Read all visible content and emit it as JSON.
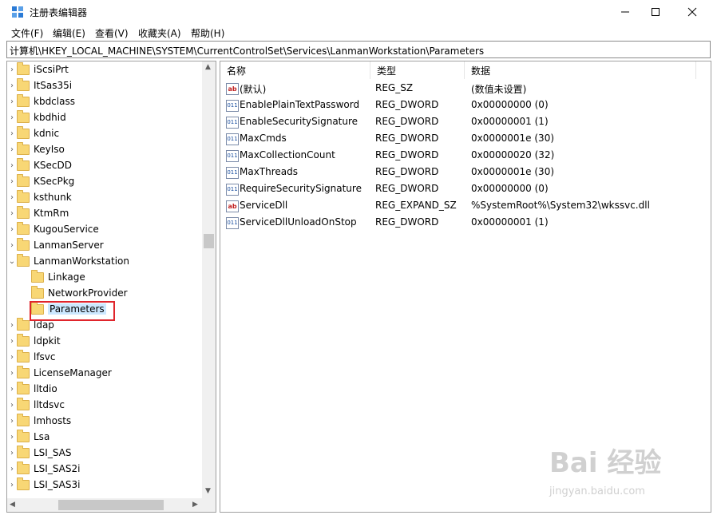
{
  "window": {
    "title": "注册表编辑器",
    "controls": {
      "minimize": "—",
      "maximize": "☐",
      "close": "✕"
    }
  },
  "menu": [
    "文件(F)",
    "编辑(E)",
    "查看(V)",
    "收藏夹(A)",
    "帮助(H)"
  ],
  "address": "计算机\\HKEY_LOCAL_MACHINE\\SYSTEM\\CurrentControlSet\\Services\\LanmanWorkstation\\Parameters",
  "tree": {
    "items": [
      {
        "label": "iScsiPrt",
        "expander": "›",
        "level": 0
      },
      {
        "label": "ItSas35i",
        "expander": "›",
        "level": 0
      },
      {
        "label": "kbdclass",
        "expander": "›",
        "level": 0
      },
      {
        "label": "kbdhid",
        "expander": "›",
        "level": 0
      },
      {
        "label": "kdnic",
        "expander": "›",
        "level": 0
      },
      {
        "label": "KeyIso",
        "expander": "›",
        "level": 0
      },
      {
        "label": "KSecDD",
        "expander": "›",
        "level": 0
      },
      {
        "label": "KSecPkg",
        "expander": "›",
        "level": 0
      },
      {
        "label": "ksthunk",
        "expander": "›",
        "level": 0
      },
      {
        "label": "KtmRm",
        "expander": "›",
        "level": 0
      },
      {
        "label": "KugouService",
        "expander": "›",
        "level": 0
      },
      {
        "label": "LanmanServer",
        "expander": "›",
        "level": 0
      },
      {
        "label": "LanmanWorkstation",
        "expander": "⌄",
        "level": 0
      },
      {
        "label": "Linkage",
        "expander": "",
        "level": 1
      },
      {
        "label": "NetworkProvider",
        "expander": "",
        "level": 1
      },
      {
        "label": "Parameters",
        "expander": "",
        "level": 1,
        "selected": true
      },
      {
        "label": "ldap",
        "expander": "›",
        "level": 0
      },
      {
        "label": "ldpkit",
        "expander": "›",
        "level": 0
      },
      {
        "label": "lfsvc",
        "expander": "›",
        "level": 0
      },
      {
        "label": "LicenseManager",
        "expander": "›",
        "level": 0
      },
      {
        "label": "lltdio",
        "expander": "›",
        "level": 0
      },
      {
        "label": "lltdsvc",
        "expander": "›",
        "level": 0
      },
      {
        "label": "lmhosts",
        "expander": "›",
        "level": 0
      },
      {
        "label": "Lsa",
        "expander": "›",
        "level": 0
      },
      {
        "label": "LSI_SAS",
        "expander": "›",
        "level": 0
      },
      {
        "label": "LSI_SAS2i",
        "expander": "›",
        "level": 0
      },
      {
        "label": "LSI_SAS3i",
        "expander": "›",
        "level": 0
      }
    ]
  },
  "list": {
    "headers": [
      "名称",
      "类型",
      "数据"
    ],
    "rows": [
      {
        "icon": "ab",
        "name": "(默认)",
        "type": "REG_SZ",
        "data": "(数值未设置)"
      },
      {
        "icon": "011",
        "name": "EnablePlainTextPassword",
        "type": "REG_DWORD",
        "data": "0x00000000 (0)"
      },
      {
        "icon": "011",
        "name": "EnableSecuritySignature",
        "type": "REG_DWORD",
        "data": "0x00000001 (1)"
      },
      {
        "icon": "011",
        "name": "MaxCmds",
        "type": "REG_DWORD",
        "data": "0x0000001e (30)"
      },
      {
        "icon": "011",
        "name": "MaxCollectionCount",
        "type": "REG_DWORD",
        "data": "0x00000020 (32)"
      },
      {
        "icon": "011",
        "name": "MaxThreads",
        "type": "REG_DWORD",
        "data": "0x0000001e (30)"
      },
      {
        "icon": "011",
        "name": "RequireSecuritySignature",
        "type": "REG_DWORD",
        "data": "0x00000000 (0)"
      },
      {
        "icon": "ab",
        "name": "ServiceDll",
        "type": "REG_EXPAND_SZ",
        "data": "%SystemRoot%\\System32\\wkssvc.dll"
      },
      {
        "icon": "011",
        "name": "ServiceDllUnloadOnStop",
        "type": "REG_DWORD",
        "data": "0x00000001 (1)"
      }
    ]
  },
  "watermark": {
    "main": "Bai 经验",
    "sub": "jingyan.baidu.com"
  },
  "colors": {
    "selection": "#cce8ff",
    "highlight_box": "#e0252c",
    "folder": "#f8d775"
  }
}
